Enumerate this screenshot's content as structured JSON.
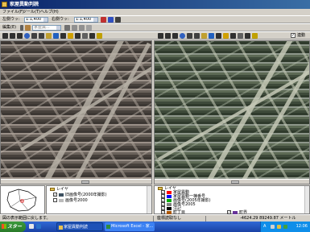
{
  "window": {
    "title": "家屋異動判読"
  },
  "menu": [
    "ファイル(F)",
    "ツール(T)",
    "ヘルプ(H)"
  ],
  "toolbar1": {
    "left_label": "左側ウッ:",
    "left_value": "1:1,400",
    "right_label": "右側ウッ:",
    "right_value": "1:1,400"
  },
  "toolbar2": {
    "edit_label": "編集(E)",
    "layer_select": "家屋異..."
  },
  "toolbar3": {
    "sync_checkbox": "✓",
    "sync_label": "連動"
  },
  "legend_left": {
    "root": "レイヤ",
    "items": [
      {
        "label": "旧画像号(2000年撮影)",
        "checked": true
      },
      {
        "label": "画像号2000",
        "checked": false
      }
    ]
  },
  "legend_right": {
    "root": "レイヤ",
    "items": [
      {
        "label": "家屋異動",
        "checked": true,
        "color": "#ff0000"
      },
      {
        "label": "家屋異動一棟番号",
        "checked": true,
        "color": "#0000ff"
      },
      {
        "label": "画像号(2005年撮影)",
        "checked": true,
        "color": "#00aa00"
      },
      {
        "label": "画像号2005",
        "checked": true,
        "color": "#808080"
      },
      {
        "label": "注記",
        "checked": true,
        "color": "#000000"
      },
      {
        "label": "町丁目",
        "checked": true,
        "color": "#aa5500"
      },
      {
        "label": "町界",
        "checked": true,
        "color": "#663399"
      }
    ]
  },
  "statusbar": {
    "message": "図の表示範囲に戻します。",
    "mode": "座標読取なし",
    "coords": "-4624.29 89249.87 メートル"
  },
  "taskbar": {
    "start": "スタート",
    "items": [
      "家屋異動判読",
      "Microsoft Excel - 家..."
    ],
    "clock": "12:06",
    "ime": "A"
  }
}
